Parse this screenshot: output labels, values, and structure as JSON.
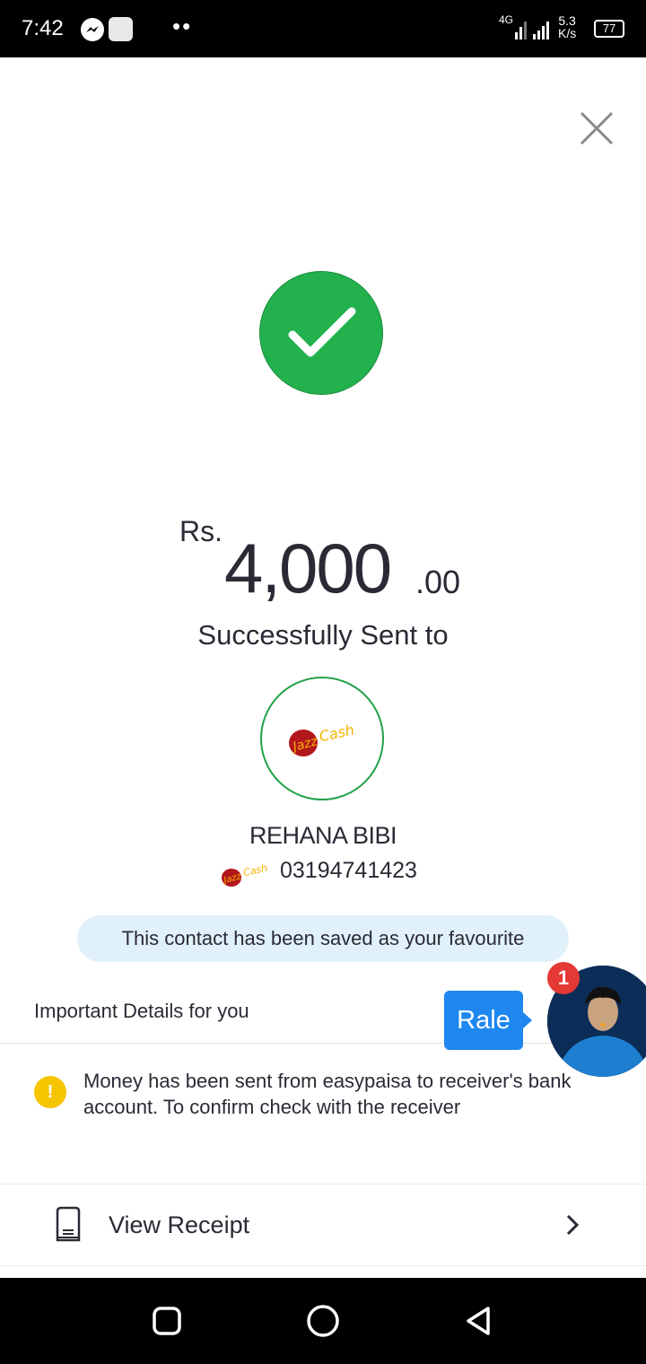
{
  "status_bar": {
    "time": "7:42",
    "network": "4G",
    "speed_value": "5.3",
    "speed_unit": "K/s",
    "battery": "77"
  },
  "amount": {
    "currency": "Rs.",
    "integer": "4,000",
    "decimal": ".00"
  },
  "status_text": "Successfully Sent to",
  "recipient": {
    "name": "REHANA BIBI",
    "phone": "03194741423",
    "logo_text": "JazzCash"
  },
  "favourite_banner": "This contact has been saved as your favourite",
  "details": {
    "title": "Important Details for you",
    "icon_glyph": "!",
    "message": "Money has been sent from easypaisa to receiver's bank account. To confirm check with the receiver"
  },
  "actions": {
    "view_receipt": "View Receipt"
  },
  "chat_head": {
    "bubble_text": "Rale",
    "badge_count": "1"
  },
  "colors": {
    "success_green": "#22b14c",
    "accent_blue": "#1e88f0",
    "banner_bg": "#e0f1fa",
    "warning_yellow": "#f7c400",
    "badge_red": "#e53935"
  }
}
